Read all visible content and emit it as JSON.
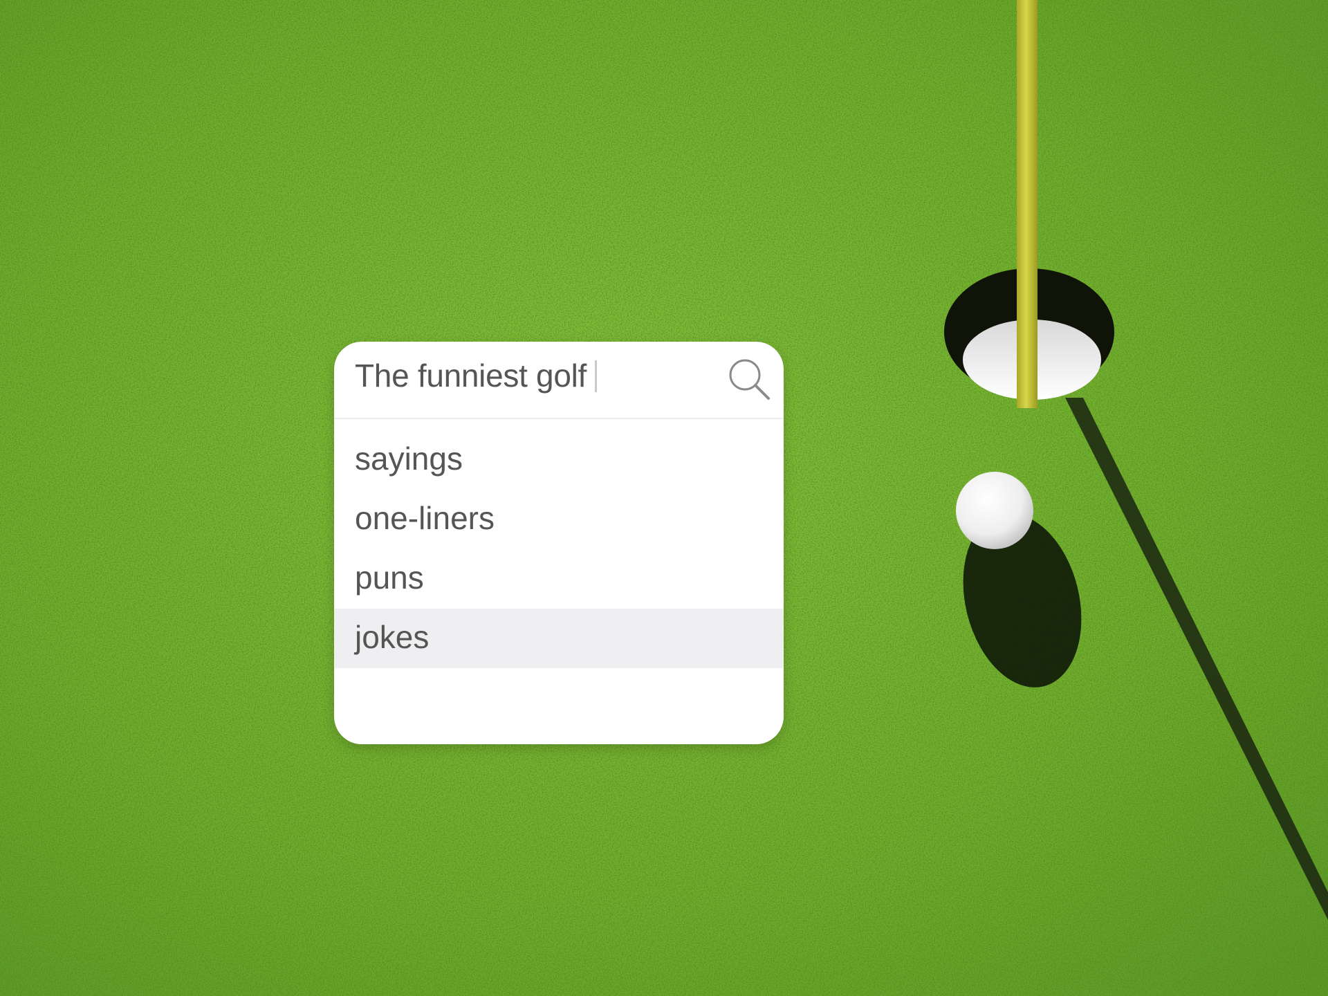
{
  "search": {
    "query": "The funniest golf",
    "icon": "search-icon"
  },
  "suggestions": [
    {
      "label": "sayings",
      "highlighted": false
    },
    {
      "label": "one-liners",
      "highlighted": false
    },
    {
      "label": "puns",
      "highlighted": false
    },
    {
      "label": "jokes",
      "highlighted": true
    }
  ],
  "colors": {
    "grass": "#6fae2a",
    "flagstick": "#c5c43a",
    "highlight": "#efeff2",
    "text": "#555555"
  }
}
